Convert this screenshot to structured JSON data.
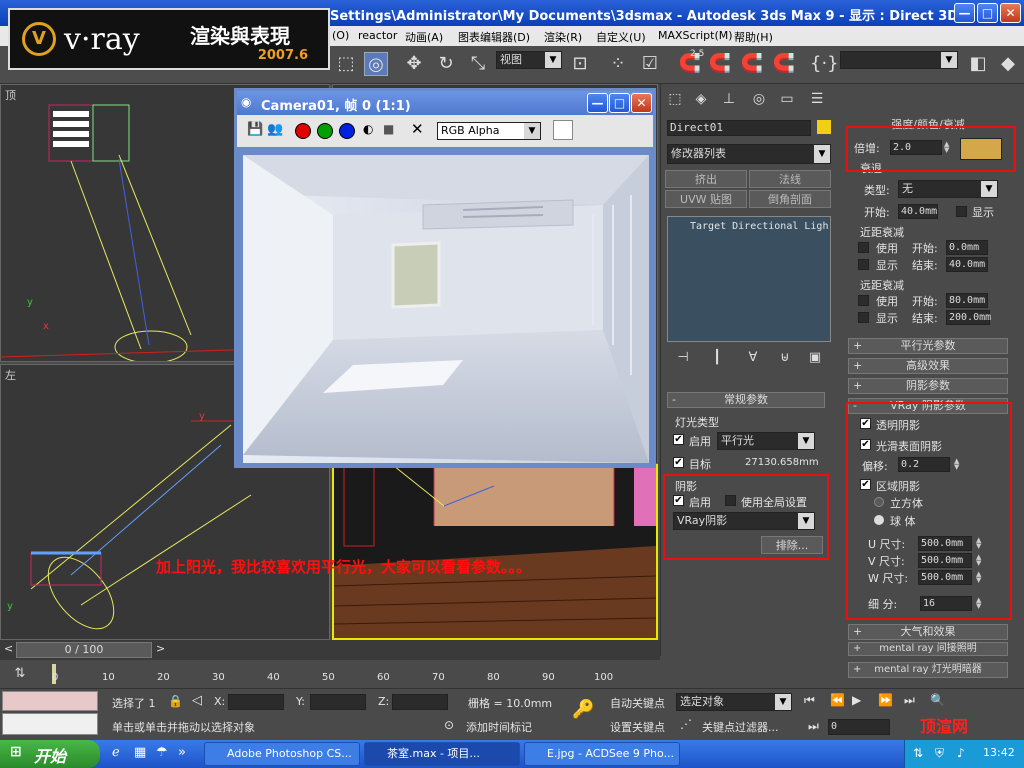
{
  "window": {
    "title": "Settings\\Administrator\\My Documents\\3dsmax  - Autodesk 3ds Max 9  - 显示 : Direct 3D",
    "min": "—",
    "max": "□",
    "close": "✕"
  },
  "logo": {
    "circle": "V",
    "brand": "v·ray",
    "chinese": "渲染與表現",
    "date": "2007.6"
  },
  "menu": [
    "(O)",
    "reactor",
    "动画(A)",
    "图表编辑器(D)",
    "渲染(R)",
    "自定义(U)",
    "MAXScript(M)",
    "帮助(H)"
  ],
  "toolbar": {
    "view_dropdown": "视图",
    "num_25": "2.5",
    "selection_set": ""
  },
  "viewports": {
    "top_label": "顶",
    "left_label": "左",
    "axis_x": "x",
    "axis_y": "y"
  },
  "camera_window": {
    "title": "Camera01, 帧 0 (1:1)",
    "channel": "RGB Alpha"
  },
  "annotation": "加上阳光，我比较喜欢用平行光，大家可以看看参数。。。",
  "command_panel": {
    "object_name": "Direct01",
    "modifier_list": "修改器列表",
    "btn_extrude": "挤出",
    "btn_normal": "法线",
    "btn_uvw": "UVW 贴图",
    "btn_bevel": "倒角剖面",
    "stack_item": "Target Directional Ligh",
    "general_params": "常规参数",
    "light_type": "灯光类型",
    "on": "启用",
    "light_kind": "平行光",
    "target": "目标",
    "target_dist": "27130.658mm",
    "shadows": "阴影",
    "shadow_on": "启用",
    "use_global": "使用全局设置",
    "shadow_type": "VRay阴影",
    "exclude": "排除..."
  },
  "right_panel": {
    "intensity_header": "强度/颜色/衰减",
    "multiplier_label": "倍增:",
    "multiplier": "2.0",
    "decay": "衰退",
    "decay_type_label": "类型:",
    "decay_type": "无",
    "start_label": "开始:",
    "start_value": "40.0mm",
    "show": "显示",
    "near_atten": "近距衰减",
    "use": "使用",
    "start": "开始:",
    "end": "结束:",
    "near_start": "0.0mm",
    "near_end": "40.0mm",
    "far_atten": "远距衰减",
    "far_start": "80.0mm",
    "far_end": "200.0mm",
    "dir_params": "平行光参数",
    "adv_effects": "高级效果",
    "shadow_params": "阴影参数",
    "vray_shadow_params": "VRay 阴影参数",
    "transparent": "透明阴影",
    "smooth": "光滑表面阴影",
    "bias_label": "偏移:",
    "bias": "0.2",
    "area_shadow": "区域阴影",
    "cube": "立方体",
    "sphere": "球 体",
    "u_size_label": "U 尺寸:",
    "v_size_label": "V 尺寸:",
    "w_size_label": "W 尺寸:",
    "u_size": "500.0mm",
    "v_size": "500.0mm",
    "w_size": "500.0mm",
    "subdivs_label": "细 分:",
    "subdivs": "16",
    "atmos": "大气和效果",
    "mr_indirect": "mental ray 间接照明",
    "mr_shadow": "mental ray 灯光明暗器"
  },
  "timeline": {
    "frame": "0 / 100",
    "ticks": [
      "0",
      "10",
      "20",
      "30",
      "40",
      "50",
      "60",
      "70",
      "80",
      "90",
      "100"
    ]
  },
  "status": {
    "selected": "选择了 1",
    "x_label": "X:",
    "y_label": "Y:",
    "z_label": "Z:",
    "grid": "栅格 = 10.0mm",
    "auto_key": "自动关键点",
    "select_obj": "选定对象",
    "set_key": "设置关键点",
    "key_filter": "关键点过滤器...",
    "prompt": "单击或单击并拖动以选择对象",
    "add_time_tag": "添加时间标记",
    "frame_field": "0",
    "watermark": "顶渲网"
  },
  "taskbar": {
    "start": "开始",
    "tasks": [
      "Adobe Photoshop CS...",
      "茶室.max    - 项目...",
      "E.jpg - ACDSee 9 Pho..."
    ],
    "clock": "13:42"
  }
}
